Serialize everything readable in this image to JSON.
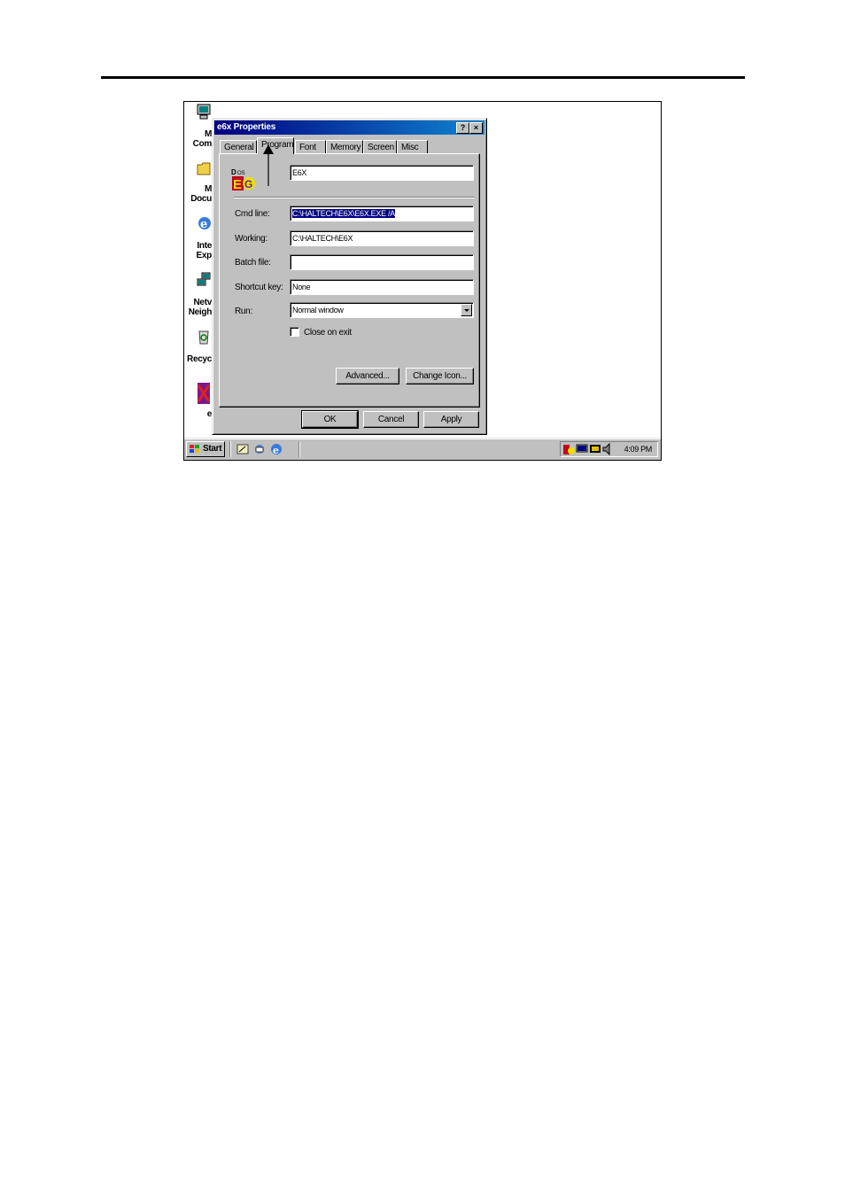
{
  "desktop": {
    "icons": [
      {
        "icon": "my-computer-icon",
        "line1": "M",
        "line2": "Com"
      },
      {
        "icon": "my-documents-icon",
        "line1": "M",
        "line2": "Docu"
      },
      {
        "icon": "internet-explorer-icon",
        "line1": "Inte",
        "line2": "Exp"
      },
      {
        "icon": "network-neighborhood-icon",
        "line1": "Netv",
        "line2": "Neigh"
      },
      {
        "icon": "recycle-bin-icon",
        "line1": "Recyc",
        "line2": ""
      },
      {
        "icon": "e6x-shortcut-icon",
        "line1": "e",
        "line2": ""
      }
    ]
  },
  "dialog": {
    "title": "e6x Properties",
    "help_btn": "?",
    "close_btn": "×",
    "tabs": [
      "General",
      "Program",
      "Font",
      "Memory",
      "Screen",
      "Misc"
    ],
    "active_tab": "Program",
    "program_icon": "e6x-program-icon",
    "program_name": "E6X",
    "fields": {
      "cmd_label": "Cmd line:",
      "cmd_value": "C:\\HALTECH\\E6X\\E6X.EXE /A",
      "working_label": "Working:",
      "working_value": "C:\\HALTECH\\E6X",
      "batch_label": "Batch file:",
      "batch_value": "",
      "shortcut_label": "Shortcut key:",
      "shortcut_value": "None",
      "run_label": "Run:",
      "run_value": "Normal window"
    },
    "close_on_exit_label": "Close on exit",
    "close_on_exit_checked": false,
    "advanced_btn": "Advanced...",
    "change_icon_btn": "Change Icon...",
    "ok_btn": "OK",
    "cancel_btn": "Cancel",
    "apply_btn": "Apply"
  },
  "taskbar": {
    "start_label": "Start",
    "clock": "4:09 PM"
  },
  "colors": {
    "face": "#c0c0c0",
    "title_active": "#000080",
    "selection": "#000080"
  }
}
